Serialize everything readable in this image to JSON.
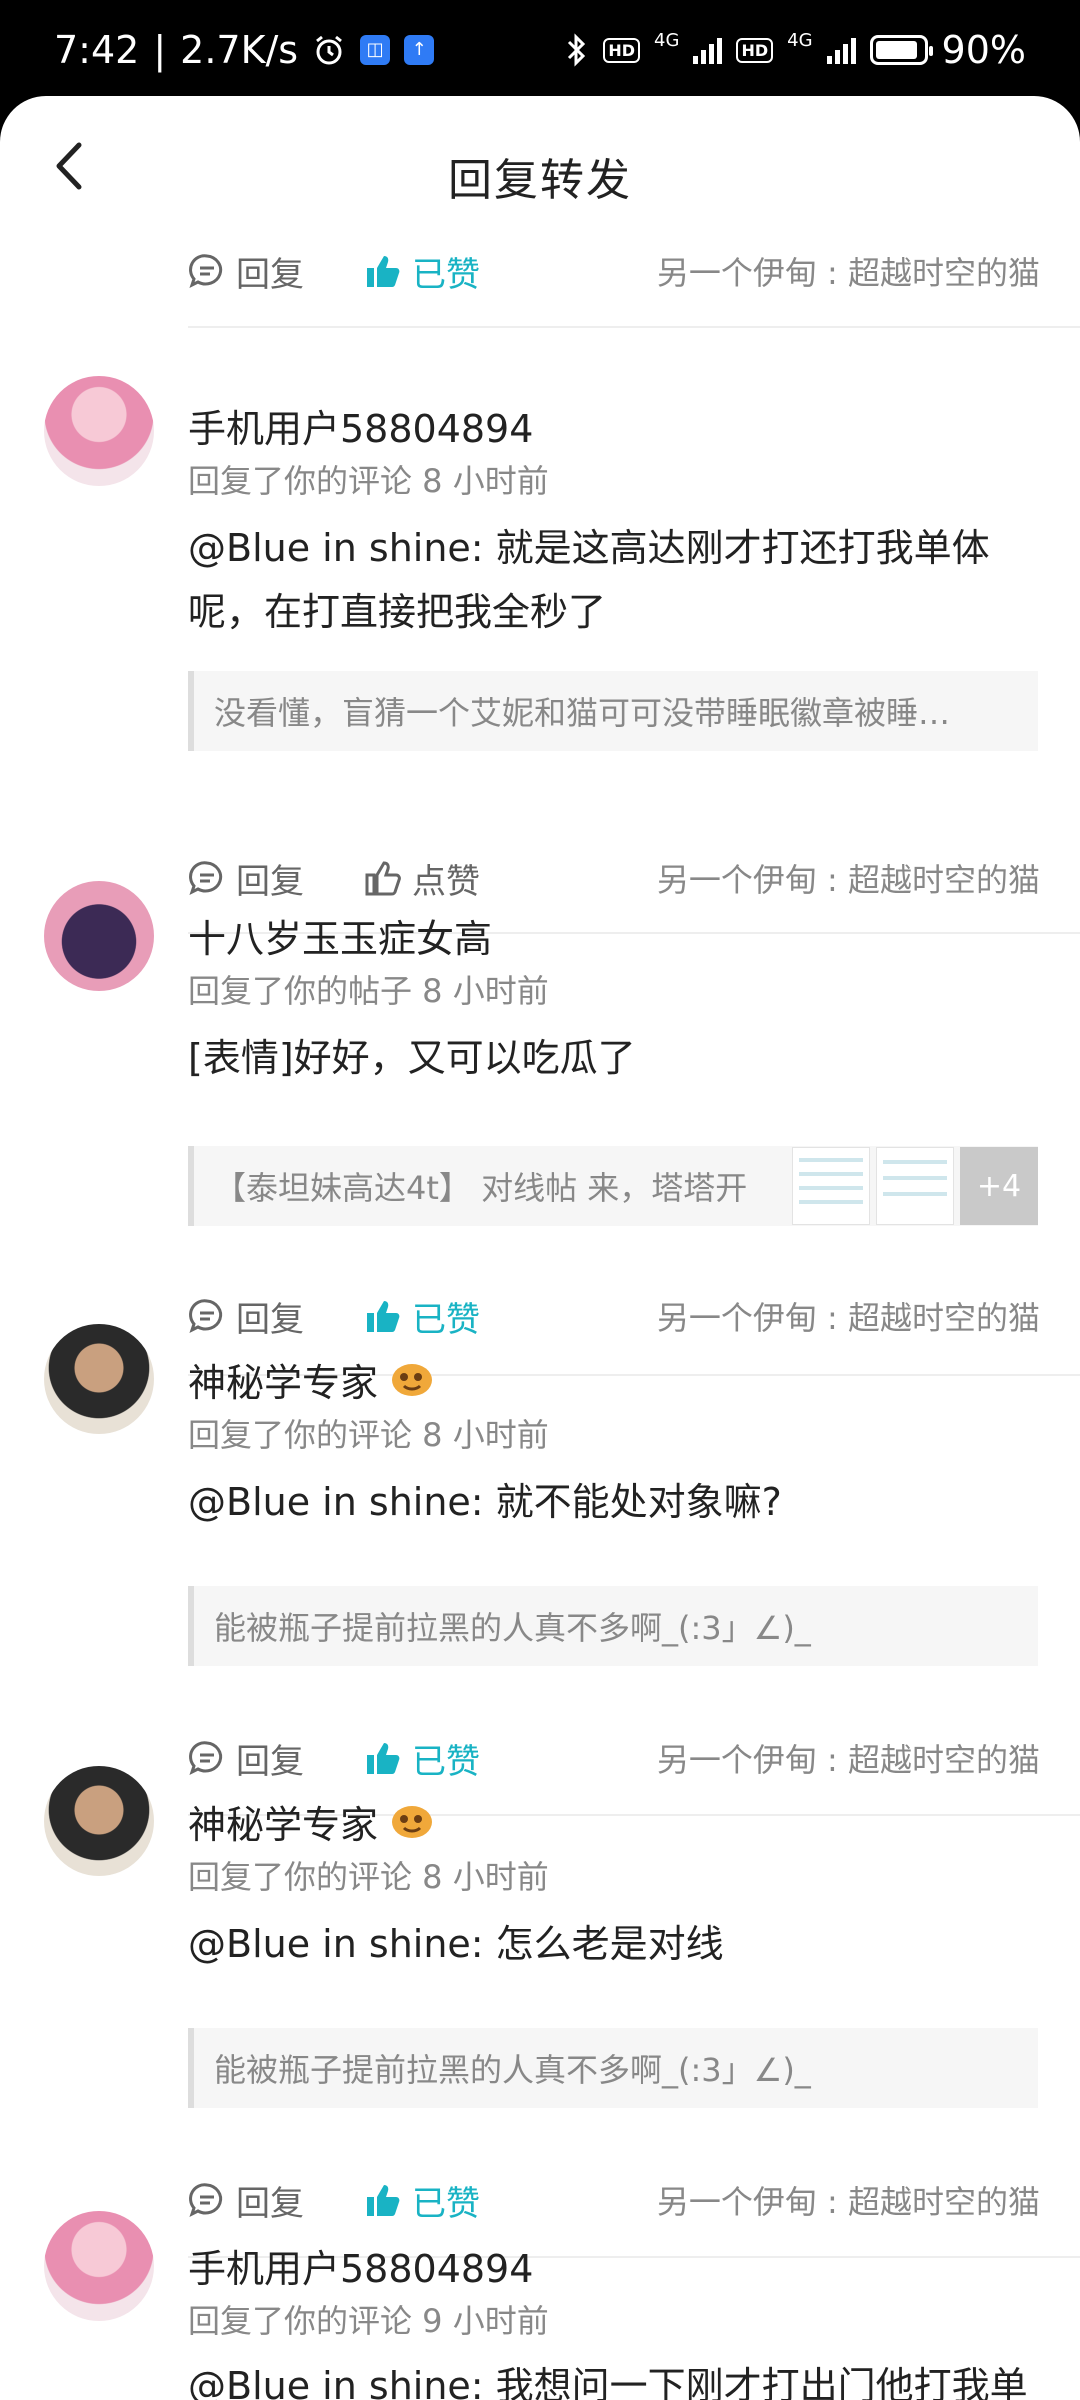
{
  "status_bar": {
    "time": "7:42",
    "speed": "2.7K/s",
    "network_1": "4G",
    "network_2": "4G",
    "hd_label": "HD",
    "battery": "90%",
    "battery_level": 0.9
  },
  "header": {
    "title": "回复转发",
    "back_icon": "back-arrow-icon"
  },
  "actions": {
    "reply": "回复",
    "liked": "已赞",
    "like": "点赞",
    "target": "另一个伊甸 : 超越时空的猫"
  },
  "items": [
    {
      "username": "手机用户58804894",
      "meta": "回复了你的评论 8 小时前",
      "content": "@Blue in shine: 就是这高达刚才打还打我单体呢，在打直接把我全秒了",
      "quote": "没看懂，盲猜一个艾妮和猫可可没带睡眠徽章被睡…",
      "like_state": "点赞"
    },
    {
      "username": "十八岁玉玉症女高",
      "meta": "回复了你的帖子 8 小时前",
      "content": "[表情]好好，又可以吃瓜了",
      "quote": "【泰坦妹高达4t】 对线帖 来，塔塔开",
      "more_images": "+4",
      "like_state": "已赞"
    },
    {
      "username": "神秘学专家",
      "meta": "回复了你的评论 8 小时前",
      "content": "@Blue in shine: 就不能处对象嘛?",
      "quote": "能被瓶子提前拉黑的人真不多啊_(:3」∠)_",
      "like_state": "已赞"
    },
    {
      "username": "神秘学专家",
      "meta": "回复了你的评论 8 小时前",
      "content": "@Blue in shine: 怎么老是对线",
      "quote": "能被瓶子提前拉黑的人真不多啊_(:3」∠)_",
      "like_state": "已赞"
    },
    {
      "username": "手机用户58804894",
      "meta": "回复了你的评论 9 小时前",
      "content": "@Blue in shine: 我想问一下刚才打出门他打我单"
    }
  ],
  "colors": {
    "accent": "#19b3c4",
    "muted": "#888888",
    "divider": "#eeeeee"
  }
}
